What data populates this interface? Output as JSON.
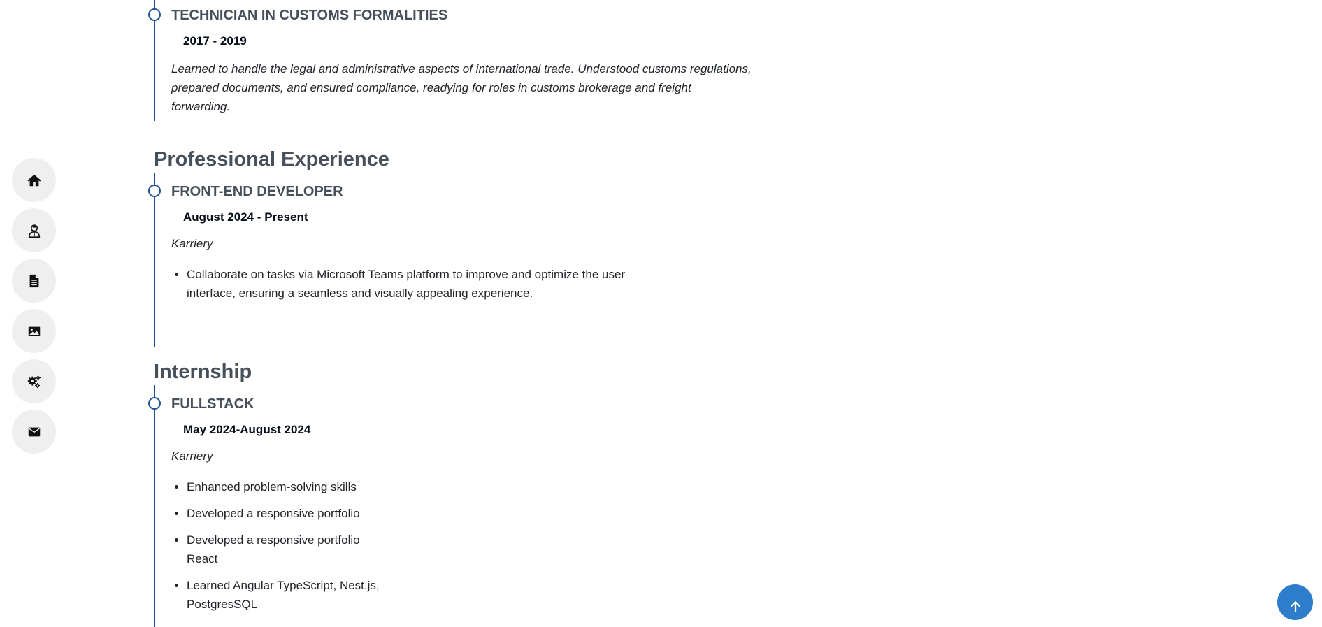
{
  "nav": {
    "items": [
      {
        "icon": "home-icon",
        "label": "Home"
      },
      {
        "icon": "user-icon",
        "label": "About"
      },
      {
        "icon": "file-icon",
        "label": "Resume"
      },
      {
        "icon": "image-icon",
        "label": "Portfolio"
      },
      {
        "icon": "gears-icon",
        "label": "Services"
      },
      {
        "icon": "envelope-icon",
        "label": "Contact"
      }
    ]
  },
  "education": {
    "items": [
      {
        "title": "Technician in customs formalities",
        "date": "2017 - 2019",
        "description": "Learned to handle the legal and administrative aspects of international trade. Understood customs regulations, prepared documents, and ensured compliance, readying for roles in customs brokerage and freight forwarding."
      }
    ]
  },
  "experience": {
    "heading": "Professional Experience",
    "items": [
      {
        "title": "Front-End Developer",
        "date": "August 2024 - Present",
        "organization": "Karriery",
        "bullets": [
          "Collaborate on tasks via Microsoft Teams platform to improve and optimize the user interface, ensuring a seamless and visually appealing experience."
        ]
      }
    ]
  },
  "internship": {
    "heading": "Internship",
    "items": [
      {
        "title": "Fullstack",
        "date": "May 2024-August 2024",
        "organization": "Karriery",
        "bullets": [
          "Enhanced problem-solving skills",
          "Developed a responsive portfolio",
          "Developed a responsive portfolio",
          "React",
          "Learned Angular TypeScript, Nest.js,",
          "PostgresSQL"
        ]
      }
    ]
  },
  "colors": {
    "accent": "#1f5297",
    "heading": "#45505b",
    "nav_bg": "#efefef",
    "back_to_top": "#2d7dcb"
  }
}
